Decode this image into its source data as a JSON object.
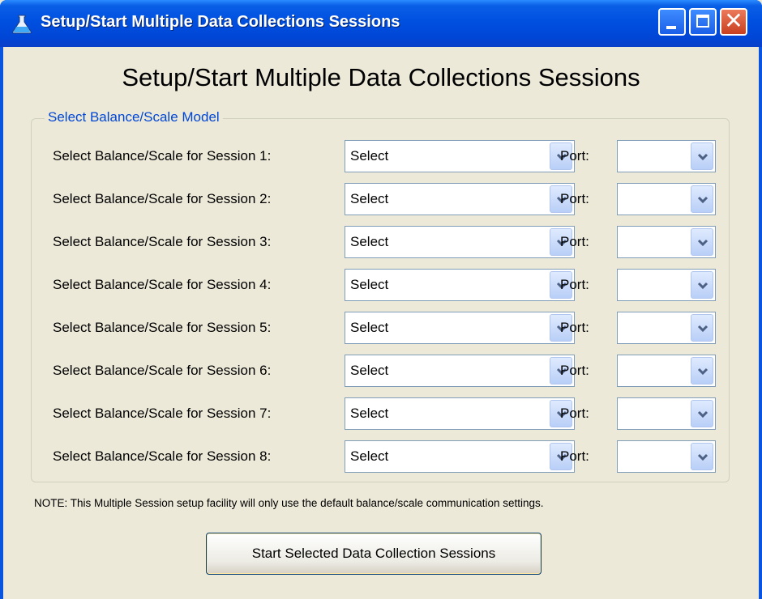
{
  "window": {
    "title": "Setup/Start Multiple Data Collections Sessions",
    "app_icon": "flask-icon",
    "controls": [
      "minimize-icon",
      "maximize-icon",
      "close-icon"
    ]
  },
  "heading": "Setup/Start Multiple Data Collections Sessions",
  "group": {
    "label": "Select Balance/Scale Model",
    "port_label": "Port:",
    "rows": [
      {
        "label": "Select Balance/Scale for Session 1:",
        "model": "Select",
        "port": ""
      },
      {
        "label": "Select Balance/Scale for Session 2:",
        "model": "Select",
        "port": ""
      },
      {
        "label": "Select Balance/Scale for Session 3:",
        "model": "Select",
        "port": ""
      },
      {
        "label": "Select Balance/Scale for Session 4:",
        "model": "Select",
        "port": ""
      },
      {
        "label": "Select Balance/Scale for Session 5:",
        "model": "Select",
        "port": ""
      },
      {
        "label": "Select Balance/Scale for Session 6:",
        "model": "Select",
        "port": ""
      },
      {
        "label": "Select Balance/Scale for Session 7:",
        "model": "Select",
        "port": ""
      },
      {
        "label": "Select Balance/Scale for Session 8:",
        "model": "Select",
        "port": ""
      }
    ]
  },
  "note": "NOTE: This Multiple Session setup facility will only use the default balance/scale communication settings.",
  "start_button": "Start Selected Data Collection Sessions",
  "colors": {
    "titlebar": "#0050e0",
    "group_label": "#0046d5",
    "background": "#ece9d8",
    "close_button": "#c8401f"
  }
}
